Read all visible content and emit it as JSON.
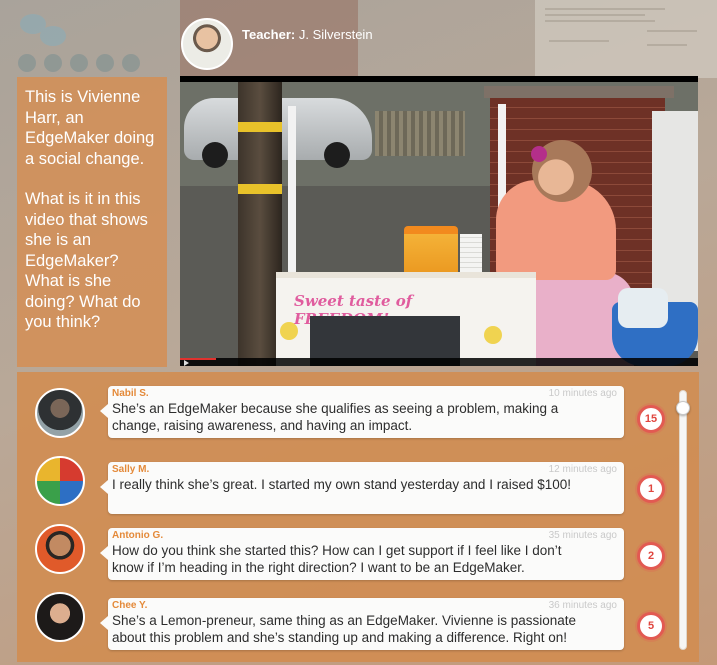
{
  "teacher": {
    "label_prefix": "Teacher:",
    "name": "J. Silverstein"
  },
  "question": {
    "intro": "This is Vivienne Harr, an EdgeMaker doing a social change.",
    "prompt": "What is it in this video that shows she is an EdgeMaker? What is she doing? What do you think?"
  },
  "video": {
    "sign_text": "Sweet taste of FREEDOM!"
  },
  "comments": [
    {
      "author": "Nabil S.",
      "time": "10 minutes ago",
      "text": "She’s an EdgeMaker because she qualifies as seeing a problem, making a change, raising awareness, and having an impact.",
      "count": "15"
    },
    {
      "author": "Sally M.",
      "time": "12 minutes ago",
      "text": "I really think she’s great. I started my own stand yesterday and I raised $100!",
      "count": "1"
    },
    {
      "author": "Antonio G.",
      "time": "35 minutes ago",
      "text": "How do you think she started this? How can I get support if I feel like I don’t know if I’m heading in the right direction? I want to be an EdgeMaker.",
      "count": "2"
    },
    {
      "author": "Chee Y.",
      "time": "36 minutes ago",
      "text": "She’s a Lemon-preneur, same thing as an EdgeMaker. Vivienne is passionate about this problem and she’s standing up and making a difference. Right on!",
      "count": "5"
    }
  ],
  "colors": {
    "panel_orange": "#d68e52",
    "author_orange": "#e48a3a",
    "count_red": "#e25a52"
  }
}
